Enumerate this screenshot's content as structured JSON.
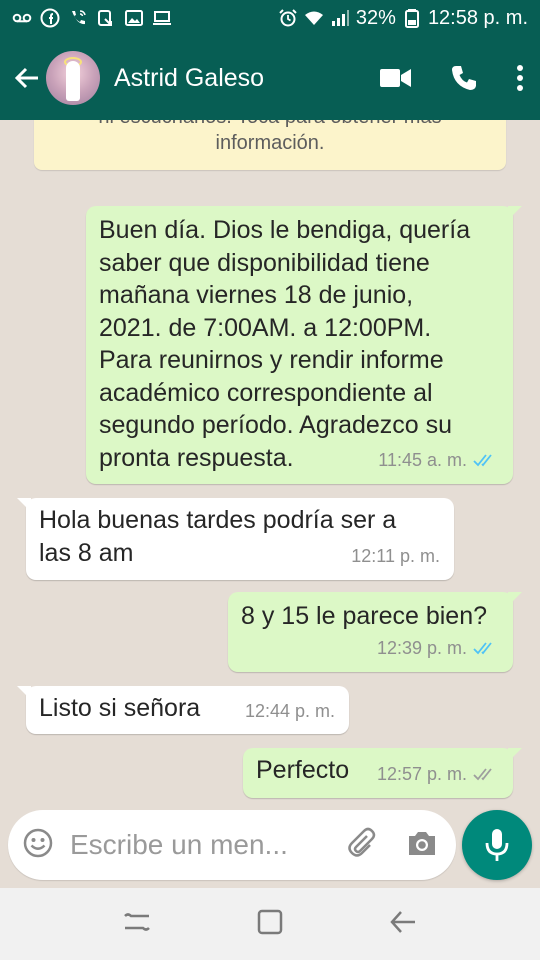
{
  "status_bar": {
    "battery": "32%",
    "time": "12:58 p. m."
  },
  "header": {
    "contact_name": "Astrid Galeso"
  },
  "notice": {
    "line1": "ni escucharlos. Toca para obtener más",
    "line2": "información."
  },
  "messages": [
    {
      "direction": "outgoing",
      "text": "Buen día. Dios le bendiga, quería\nsaber que disponibilidad tiene\nmañana viernes 18 de junio,\n2021. de 7:00AM. a 12:00PM.\nPara reunirnos y rendir informe\nacadémico correspondiente al\nsegundo período. Agradezco su\npronta respuesta.",
      "time": "11:45 a. m.",
      "status": "read"
    },
    {
      "direction": "incoming",
      "text": "Hola buenas tardes podría ser a\nlas 8 am",
      "time": "12:11 p. m."
    },
    {
      "direction": "outgoing",
      "text": "8 y 15 le parece bien?",
      "time": "12:39 p. m.",
      "status": "read"
    },
    {
      "direction": "incoming",
      "text": "Listo si señora",
      "time": "12:44 p. m."
    },
    {
      "direction": "outgoing",
      "text": "Perfecto",
      "time": "12:57 p. m.",
      "status": "delivered"
    }
  ],
  "composer": {
    "placeholder": "Escribe un men..."
  },
  "colors": {
    "header": "#075e54",
    "outgoing_bubble": "#dcf8c6",
    "incoming_bubble": "#ffffff",
    "chat_background": "#e5ddd5",
    "read_ticks": "#4fc3f7",
    "mic_button": "#00897b"
  },
  "icons": {
    "status_left": [
      "voicemail-icon",
      "facebook-icon",
      "wifi-call-icon",
      "missed-call-icon",
      "gallery-icon",
      "laptop-icon"
    ],
    "status_right": [
      "alarm-icon",
      "wifi-icon",
      "signal-icon",
      "battery-icon"
    ],
    "header": [
      "back-arrow-icon",
      "video-call-icon",
      "phone-icon",
      "more-vert-icon"
    ],
    "composer": [
      "emoji-icon",
      "attach-icon",
      "camera-icon",
      "mic-icon"
    ],
    "nav": [
      "recents-icon",
      "home-icon",
      "back-icon"
    ]
  }
}
